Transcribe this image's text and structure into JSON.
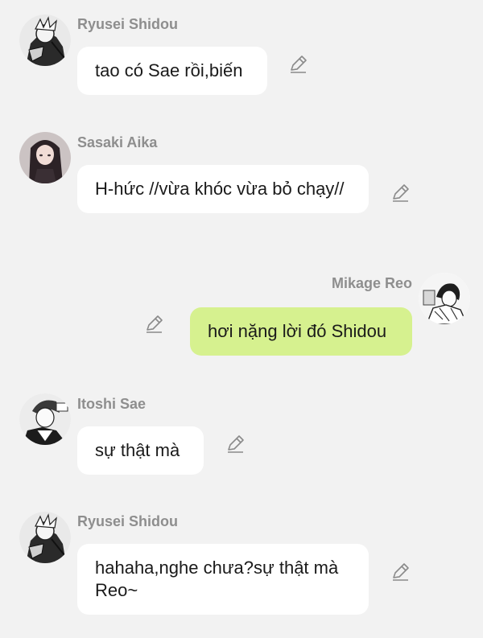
{
  "colors": {
    "background": "#f2f2f2",
    "bubble_other": "#ffffff",
    "bubble_self": "#d6f18f",
    "name_text": "#8e8e8e",
    "icon": "#8a8a8a"
  },
  "messages": [
    {
      "sender": "Ryusei Shidou",
      "text": "tao có Sae rồi,biến",
      "side": "left",
      "icon": "pencil-icon"
    },
    {
      "sender": "Sasaki Aika",
      "text": "H-hức //vừa khóc vừa bỏ chạy//",
      "side": "left",
      "icon": "pencil-icon"
    },
    {
      "sender": "Mikage Reo",
      "text": "hơi nặng lời đó Shidou",
      "side": "right",
      "icon": "pencil-icon"
    },
    {
      "sender": "Itoshi Sae",
      "text": "sự thật mà",
      "side": "left",
      "icon": "pencil-icon"
    },
    {
      "sender": "Ryusei Shidou",
      "text": "hahaha,nghe chưa?sự thật mà Reo~",
      "side": "left",
      "icon": "pencil-icon"
    }
  ]
}
